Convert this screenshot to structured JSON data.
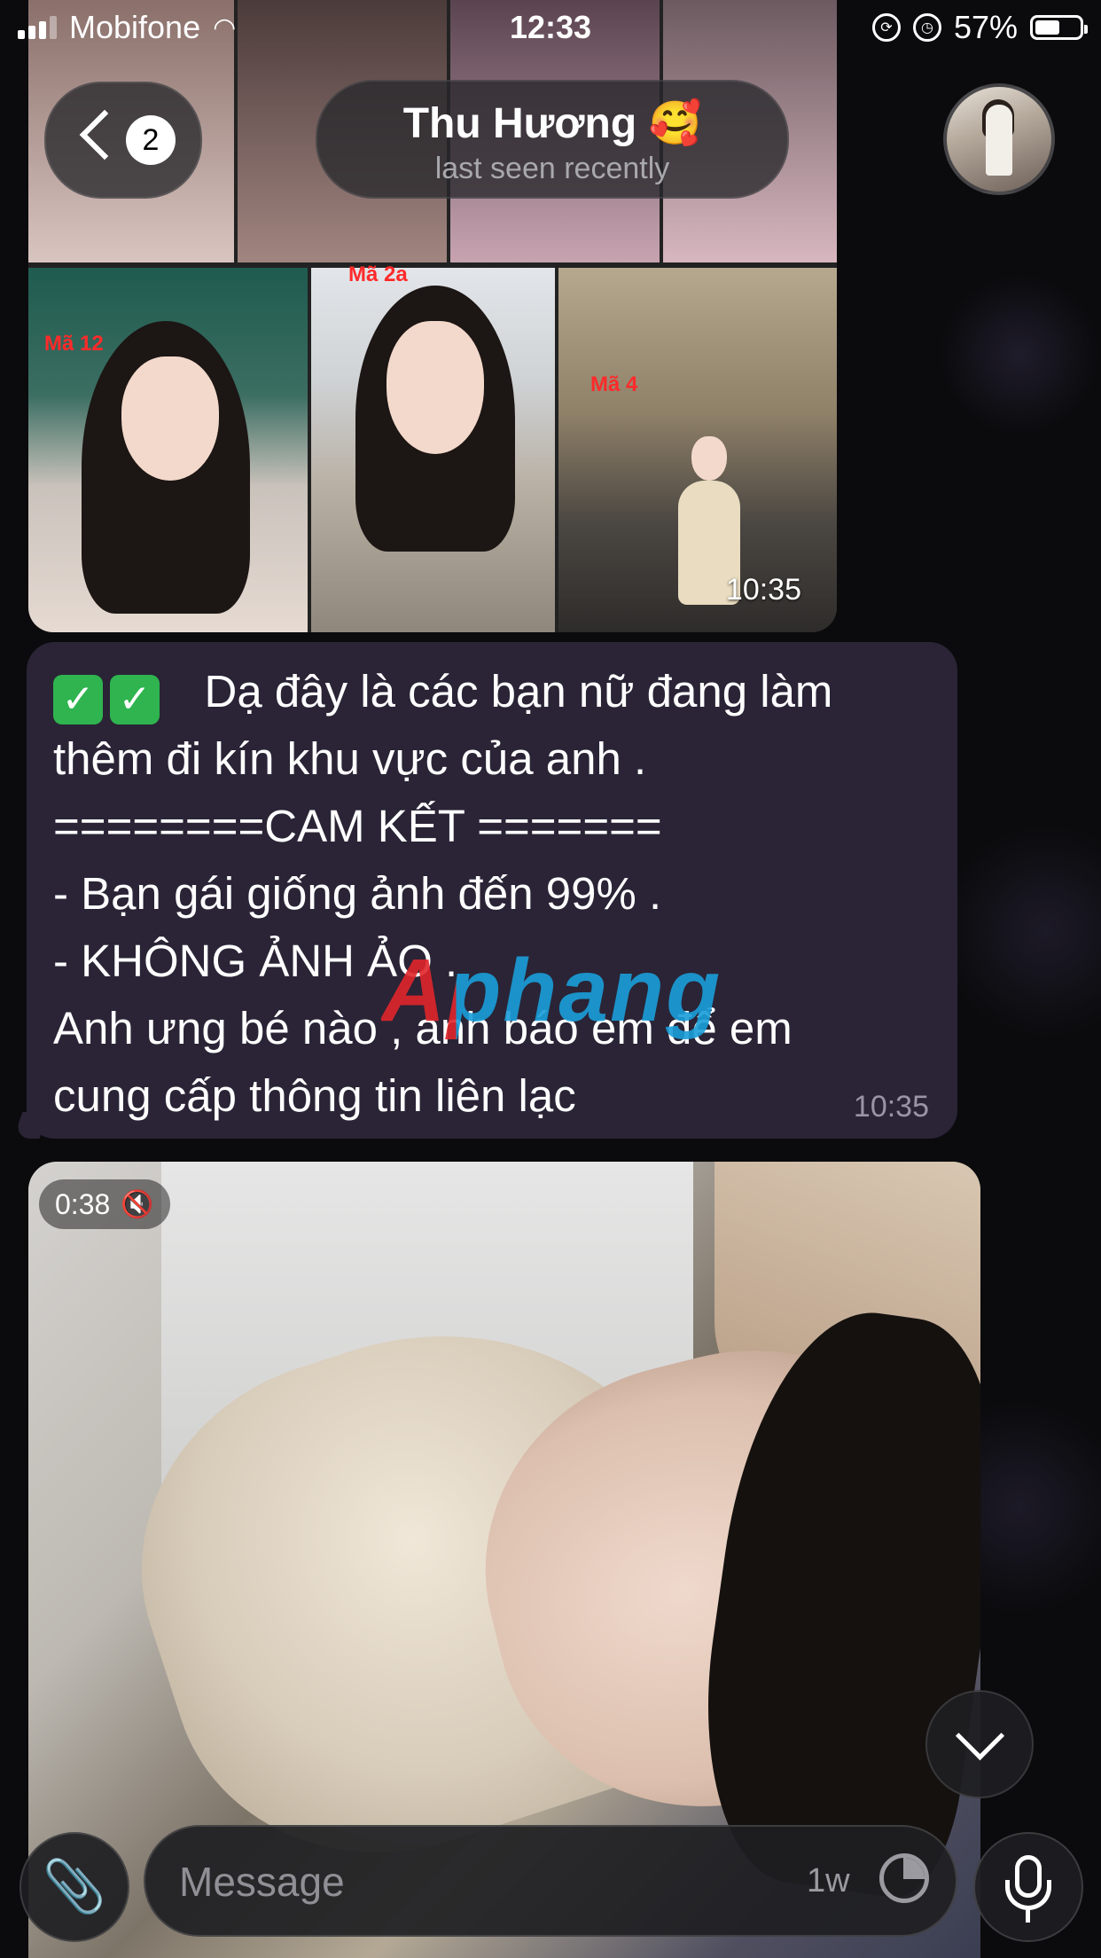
{
  "status_bar": {
    "carrier": "Mobifone",
    "time": "12:33",
    "battery": "57%",
    "battery_level": 0.57
  },
  "header": {
    "back_count": "2",
    "chat_name": "Thu Hương 🥰",
    "chat_status": "last seen recently"
  },
  "album": {
    "labels": [
      "Mã 12",
      "Mã 2a",
      "Mã 4"
    ],
    "time": "10:35"
  },
  "message": {
    "lines": [
      "Dạ đây là các bạn nữ đang làm",
      "thêm đi kín khu vực của anh .",
      "========CAM KẾT =======",
      "- Bạn gái giống ảnh đến 99% .",
      "- KHÔNG ẢNH ẢO .",
      "Anh ưng bé nào , anh báo em để em",
      "cung cấp thông tin liên lạc"
    ],
    "time": "10:35"
  },
  "watermark": "Aphang",
  "video": {
    "duration": "0:38",
    "muted_icon": "speaker-muted-icon"
  },
  "input": {
    "placeholder": "Message",
    "timer_label": "1w"
  },
  "colors": {
    "bubble": "#2a2436",
    "background": "#0b0b0d",
    "label_red": "#ff2a2a"
  }
}
